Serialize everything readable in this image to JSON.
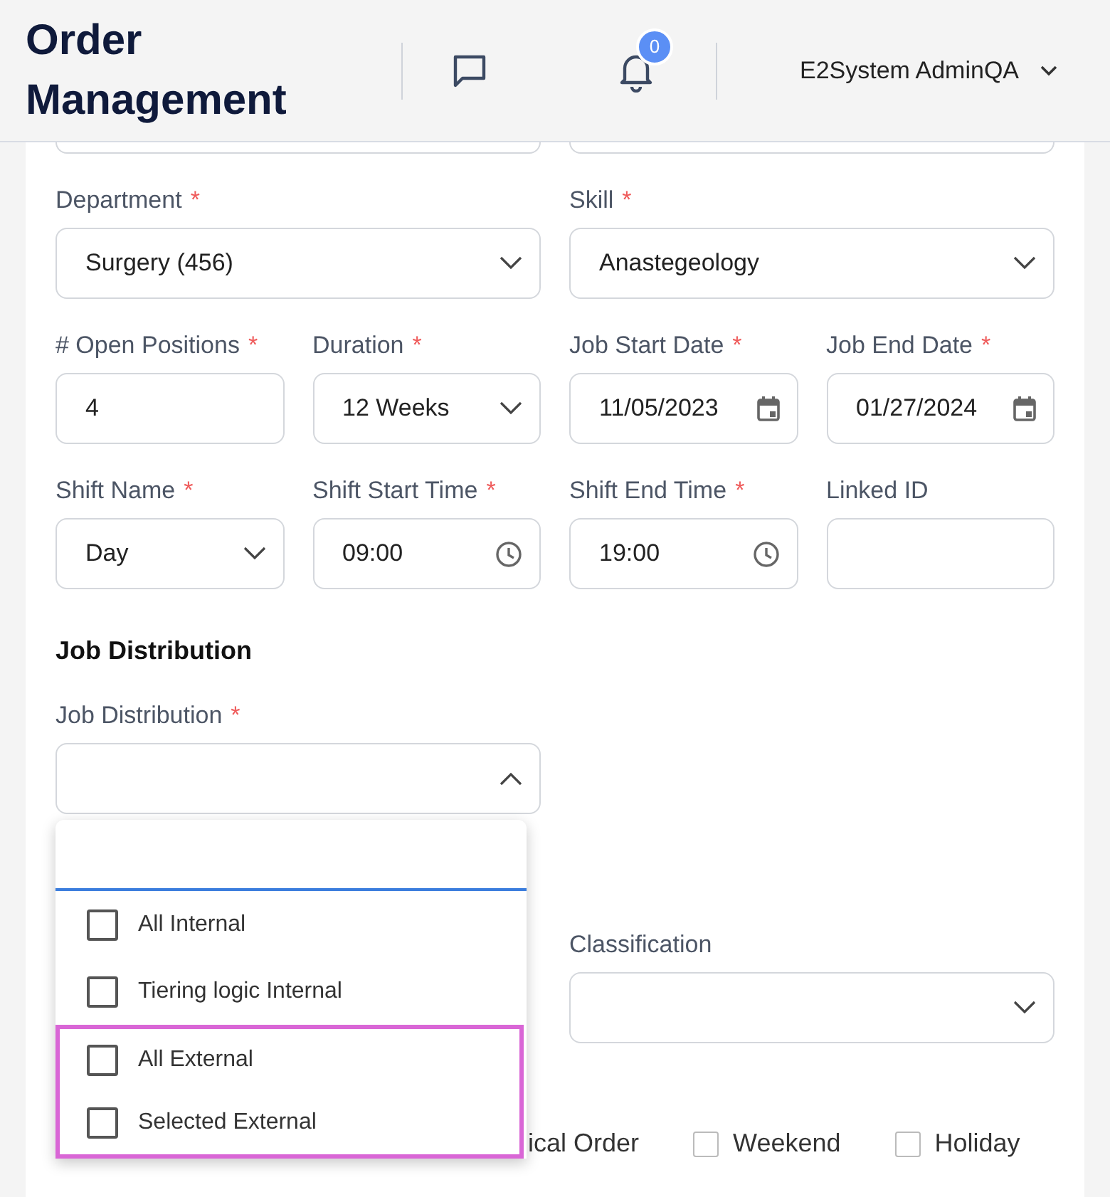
{
  "header": {
    "title": "Order Management",
    "notifications": "0",
    "user": "E2System AdminQA"
  },
  "rows": [
    [
      {
        "label": "Department",
        "required_mark": "*",
        "kind": "select",
        "value": "Surgery (456)",
        "wide": true
      },
      {
        "label": "Skill",
        "required_mark": "*",
        "kind": "select",
        "value": "Anastegeology",
        "wide": true
      }
    ],
    [
      {
        "label": "# Open Positions",
        "required_mark": "*",
        "kind": "text",
        "value": "4"
      },
      {
        "label": "Duration",
        "required_mark": "*",
        "kind": "select",
        "value": "12 Weeks"
      },
      {
        "label": "Job Start Date",
        "required_mark": "*",
        "kind": "date",
        "value": "11/05/2023"
      },
      {
        "label": "Job End Date",
        "required_mark": "*",
        "kind": "date",
        "value": "01/27/2024"
      }
    ],
    [
      {
        "label": "Shift Name",
        "required_mark": "*",
        "kind": "select",
        "value": "Day"
      },
      {
        "label": "Shift Start Time",
        "required_mark": "*",
        "kind": "time",
        "value": "09:00"
      },
      {
        "label": "Shift End Time",
        "required_mark": "*",
        "kind": "time",
        "value": "19:00"
      },
      {
        "label": "Linked ID",
        "kind": "text"
      }
    ]
  ],
  "section": "Job Distribution",
  "distribution": {
    "label": "Job Distribution",
    "required_mark": "*",
    "expanded": true,
    "options": [
      {
        "label": "All Internal",
        "checked": false,
        "highlighted": false
      },
      {
        "label": "Tiering logic Internal",
        "checked": false,
        "highlighted": false
      },
      {
        "label": "All External",
        "checked": false,
        "highlighted": true
      },
      {
        "label": "Selected External",
        "checked": false,
        "highlighted": true
      }
    ]
  },
  "classification": {
    "label": "Classification"
  },
  "flags": [
    {
      "label": "ical Order"
    },
    {
      "label": "Weekend",
      "checked": false
    },
    {
      "label": "Holiday",
      "checked": false
    }
  ]
}
